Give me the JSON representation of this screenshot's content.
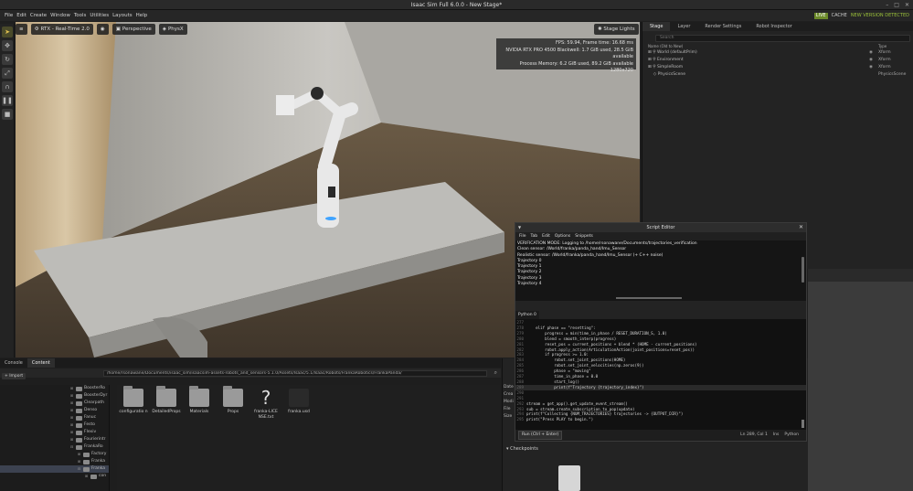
{
  "window": {
    "title": "Isaac Sim Full 6.0.0 - New Stage*",
    "controls": [
      "–",
      "□",
      "✕"
    ]
  },
  "menu": {
    "items": [
      "File",
      "Edit",
      "Create",
      "Window",
      "Tools",
      "Utilities",
      "Layouts",
      "Help"
    ],
    "live": "LIVE",
    "cache": "CACHE",
    "new_version": "NEW VERSION DETECTED"
  },
  "viewport": {
    "renderer": "RTX - Real-Time 2.0",
    "camera": "Perspective",
    "physics": "PhysX",
    "stage_lights": "Stage Lights",
    "stats": [
      "FPS: 59.94, Frame time: 16.68 ms",
      "NVIDIA RTX PRO 4500 Blackwell: 1.7 GiB used, 28.5 GiB available",
      "Process Memory: 6.2 GiB used, 89.2 GiB available",
      "1280x720"
    ]
  },
  "stage_panel": {
    "tabs": [
      "Stage",
      "Layer",
      "Render Settings",
      "Robot Inspector"
    ],
    "search_placeholder": "Search",
    "col_name": "Name (Old to New)",
    "col_type": "Type",
    "rows": [
      {
        "name": "World (defaultPrim)",
        "type": "Xform"
      },
      {
        "name": "Environment",
        "type": "Xform"
      },
      {
        "name": "SimpleRoom",
        "type": "Xform"
      },
      {
        "name": "PhysicsScene",
        "type": "PhysicsScene"
      }
    ]
  },
  "content_panel": {
    "tabs": [
      "Console",
      "Content"
    ],
    "import_label": "Import",
    "path": "/home/rsonawane/Documents/isaac_sim/isaacsim-assets-robots_and_sensors-5.1.0/Assets/Isaac/5.1/Isaac/Robots/FrankaRobotics/FrankaPanda/",
    "tree": [
      "BoosterRo",
      "BoosterDyr",
      "Clearpath",
      "Denso",
      "Fanuc",
      "Festo",
      "Flexiv",
      "Fourierintr",
      "FrankaRo",
      "Factory",
      "Franka",
      "Franka",
      "con"
    ],
    "files": [
      {
        "label": "configuratio n",
        "kind": "folder"
      },
      {
        "label": "DetailedProps",
        "kind": "folder"
      },
      {
        "label": "Materials",
        "kind": "folder"
      },
      {
        "label": "Props",
        "kind": "folder"
      },
      {
        "label": "franka-LICE NSE.txt",
        "kind": "unknown"
      },
      {
        "label": "franka.usd",
        "kind": "usd"
      }
    ]
  },
  "property_panel": {
    "side_labels": [
      "Date",
      "Crea",
      "Modi",
      "File",
      "Size"
    ],
    "checkpoints": "Checkpoints"
  },
  "script_editor": {
    "title": "Script Editor",
    "menu": [
      "File",
      "Tab",
      "Edit",
      "Options",
      "Snippets"
    ],
    "log": [
      "VERIFICATION MODE: Logging to /home/rsonawane/Documents/trajectories_verification",
      "  Clean sensor: /World/franka/panda_hand/Imu_Sensor",
      "  Realistic sensor: /World/franka/panda_hand/Imu_Sensor (+ C++ noise)",
      "Trajectory 0",
      "Trajectory 1",
      "Trajectory 2",
      "Trajectory 3",
      "Trajectory 4"
    ],
    "tab": "Python 0",
    "code": [
      {
        "ln": "277",
        "text": ""
      },
      {
        "ln": "278",
        "text": "    elif phase == \"resetting\":"
      },
      {
        "ln": "279",
        "text": "        progress = min(time_in_phase / RESET_DURATION_S, 1.0)"
      },
      {
        "ln": "280",
        "text": "        blend = smooth_interp(progress)"
      },
      {
        "ln": "281",
        "text": "        reset_pos = current_positions + blend * (HOME - current_positions)"
      },
      {
        "ln": "282",
        "text": "        robot.apply_action(ArticulationAction(joint_positions=reset_pos))"
      },
      {
        "ln": "283",
        "text": "        if progress >= 1.0:"
      },
      {
        "ln": "284",
        "text": "            robot.set_joint_positions(HOME)"
      },
      {
        "ln": "285",
        "text": "            robot.set_joint_velocities(np.zeros(9))"
      },
      {
        "ln": "286",
        "text": "            phase = \"moving\""
      },
      {
        "ln": "287",
        "text": "            time_in_phase = 0.0"
      },
      {
        "ln": "288",
        "text": "            start_log()"
      },
      {
        "ln": "289",
        "text": "            print(f\"Trajectory {trajectory_index}\")"
      },
      {
        "ln": "290",
        "text": ""
      },
      {
        "ln": "291",
        "text": ""
      },
      {
        "ln": "292",
        "text": "stream = get_app().get_update_event_stream()"
      },
      {
        "ln": "293",
        "text": "sub = stream.create_subscription_to_pop(update)"
      },
      {
        "ln": "294",
        "text": "print(f\"Collecting {NUM_TRAJECTORIES} trajectories -> {OUTPUT_DIR}\")"
      },
      {
        "ln": "295",
        "text": "print(\"Press PLAY to begin.\")"
      }
    ],
    "run_label": "Run (Ctrl + Enter)",
    "cursor": "Ln 289, Col 1",
    "mode": "Ins",
    "language": "Python"
  }
}
